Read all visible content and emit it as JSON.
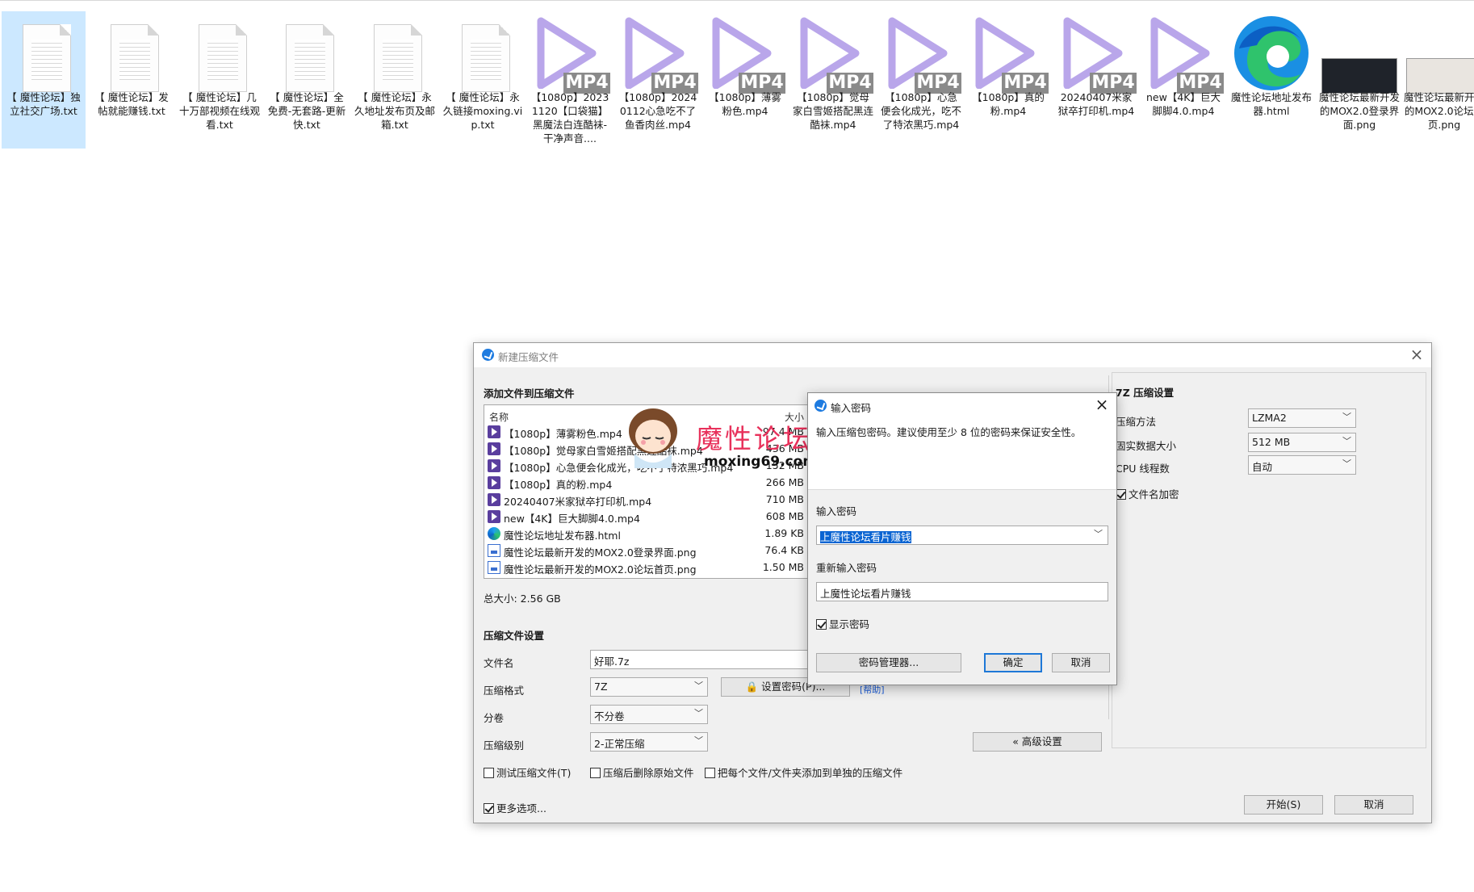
{
  "desktop": {
    "icons": [
      {
        "label": "【 魔性论坛】独立社交广场.txt",
        "type": "txt",
        "selected": true
      },
      {
        "label": "【 魔性论坛】发帖就能赚钱.txt",
        "type": "txt"
      },
      {
        "label": "【 魔性论坛】几十万部视频在线观看.txt",
        "type": "txt"
      },
      {
        "label": "【 魔性论坛】全免费-无套路-更新快.txt",
        "type": "txt"
      },
      {
        "label": "【 魔性论坛】永久地址发布页及邮箱.txt",
        "type": "txt"
      },
      {
        "label": "【 魔性论坛】永久链接moxing.vip.txt",
        "type": "txt"
      },
      {
        "label": "【1080p】20231120【口袋猫】黑魔法白连酷袜-干净声音....",
        "type": "mp4"
      },
      {
        "label": "【1080p】20240112心急吃不了鱼香肉丝.mp4",
        "type": "mp4"
      },
      {
        "label": "【1080p】薄雾粉色.mp4",
        "type": "mp4"
      },
      {
        "label": "【1080p】觉母家白雪姬搭配黑连酷袜.mp4",
        "type": "mp4"
      },
      {
        "label": "【1080p】心急便会化成光，吃不了特浓黑巧.mp4",
        "type": "mp4"
      },
      {
        "label": "【1080p】真的粉.mp4",
        "type": "mp4"
      },
      {
        "label": "20240407米家狱卒打印机.mp4",
        "type": "mp4"
      },
      {
        "label": "new【4K】巨大脚脚4.0.mp4",
        "type": "mp4"
      },
      {
        "label": "魔性论坛地址发布器.html",
        "type": "html"
      },
      {
        "label": "魔性论坛最新开发的MOX2.0登录界面.png",
        "type": "png"
      },
      {
        "label": "魔性论坛最新开发的MOX2.0论坛首页.png",
        "type": "png"
      }
    ],
    "mp4_badge": "MP4"
  },
  "dialog": {
    "title": "新建压缩文件",
    "close_icon": "×",
    "add_files_title": "添加文件到压缩文件",
    "file_list": {
      "col_name": "名称",
      "col_size": "大小",
      "rows": [
        {
          "name": "【1080p】薄雾粉色.mp4",
          "size": "97.4 MB",
          "icon": "mp4"
        },
        {
          "name": "【1080p】觉母家白雪姬搭配黑连酷袜.mp4",
          "size": "436 MB",
          "icon": "mp4"
        },
        {
          "name": "【1080p】心急便会化成光，吃不了特浓黑巧.mp4",
          "size": "152 MB",
          "icon": "mp4"
        },
        {
          "name": "【1080p】真的粉.mp4",
          "size": "266 MB",
          "icon": "mp4"
        },
        {
          "name": "20240407米家狱卒打印机.mp4",
          "size": "710 MB",
          "icon": "mp4"
        },
        {
          "name": "new【4K】巨大脚脚4.0.mp4",
          "size": "608 MB",
          "icon": "mp4"
        },
        {
          "name": "魔性论坛地址发布器.html",
          "size": "1.89 KB",
          "icon": "edge"
        },
        {
          "name": "魔性论坛最新开发的MOX2.0登录界面.png",
          "size": "76.4 KB",
          "icon": "png"
        },
        {
          "name": "魔性论坛最新开发的MOX2.0论坛首页.png",
          "size": "1.50 MB",
          "icon": "png"
        }
      ]
    },
    "total_size": "总大小: 2.56 GB",
    "archive_settings_title": "压缩文件设置",
    "filename_label": "文件名",
    "filename_value": "好耶.7z",
    "format_label": "压缩格式",
    "format_value": "7Z",
    "set_password_button": "设置密码(P)...",
    "help_link": "[帮助]",
    "split_label": "分卷",
    "split_value": "不分卷",
    "level_label": "压缩级别",
    "level_value": "2-正常压缩",
    "advanced_button": "« 高级设置",
    "test_checkbox": "测试压缩文件(T)",
    "delete_checkbox": "压缩后删除原始文件",
    "separate_checkbox": "把每个文件/文件夹添加到单独的压缩文件",
    "more_options": "更多选项...",
    "start_button": "开始(S)",
    "cancel_button": "取消",
    "chevron_icon": "﹀",
    "seven_z": {
      "title": "7Z 压缩设置",
      "method_label": "压缩方法",
      "method_value": "LZMA2",
      "dict_label": "固实数据大小",
      "dict_value": "512 MB",
      "cpu_label": "CPU 线程数",
      "cpu_value": "自动",
      "encrypt_names": "文件名加密"
    }
  },
  "password_dialog": {
    "title": "输入密码",
    "hint": "输入压缩包密码。建议使用至少 8 位的密码来保证安全性。",
    "enter_label": "输入密码",
    "enter_value": "上魔性论坛看片赚钱",
    "reenter_label": "重新输入密码",
    "reenter_value": "上魔性论坛看片赚钱",
    "show_password": "显示密码",
    "manager_button": "密码管理器...",
    "ok_button": "确定",
    "cancel_button": "取消",
    "close_icon": "×"
  },
  "watermark": {
    "text": "魔性论坛",
    "url": "moxing69.com"
  },
  "colors": {
    "accent": "#1e78d7",
    "selection": "#0a64d2",
    "mp4_purple": "#b9a6ea",
    "watermark": "#e8315b"
  }
}
